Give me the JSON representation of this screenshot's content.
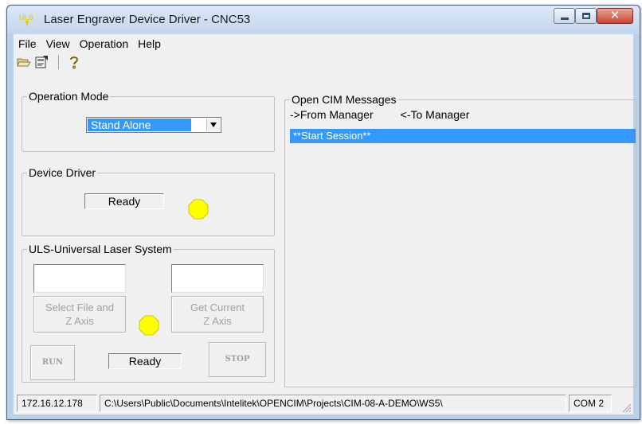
{
  "window": {
    "title": "Laser Engraver Device Driver - CNC53",
    "app_icon": "uls-logo-icon",
    "app_icon_text": "ULS",
    "controls": {
      "close_symbol": "✕"
    }
  },
  "menu": [
    "File",
    "View",
    "Operation",
    "Help"
  ],
  "toolbar": {
    "icons": [
      "open-folder-icon",
      "properties-icon",
      "help-question-icon"
    ]
  },
  "operation_mode": {
    "title": "Operation Mode",
    "selected": "Stand Alone"
  },
  "device_driver": {
    "title": "Device Driver",
    "status": "Ready",
    "lamp_color": "#ffff00"
  },
  "uls": {
    "title": "ULS-Universal Laser System",
    "file_field_value": "",
    "z_field_value": "",
    "select_file_button": "Select File and\nZ Axis",
    "get_z_button": "Get Current\nZ Axis",
    "run_button": "RUN",
    "stop_button": "STOP",
    "status": "Ready",
    "lamp_color": "#ffff00"
  },
  "messages": {
    "title": "Open CIM Messages",
    "from_manager": "->From Manager",
    "to_manager": "<-To Manager",
    "items": [
      "**Start Session**"
    ]
  },
  "statusbar": {
    "ip": "172.16.12.178",
    "path": "C:\\Users\\Public\\Documents\\Intelitek\\OPENCIM\\Projects\\CIM-08-A-DEMO\\WS5\\",
    "port": "COM 2"
  },
  "colors": {
    "selection": "#3399ff",
    "window_frame": "#b9d1ea",
    "close_button": "#c7452f",
    "disabled_text": "#a0a0a0"
  }
}
